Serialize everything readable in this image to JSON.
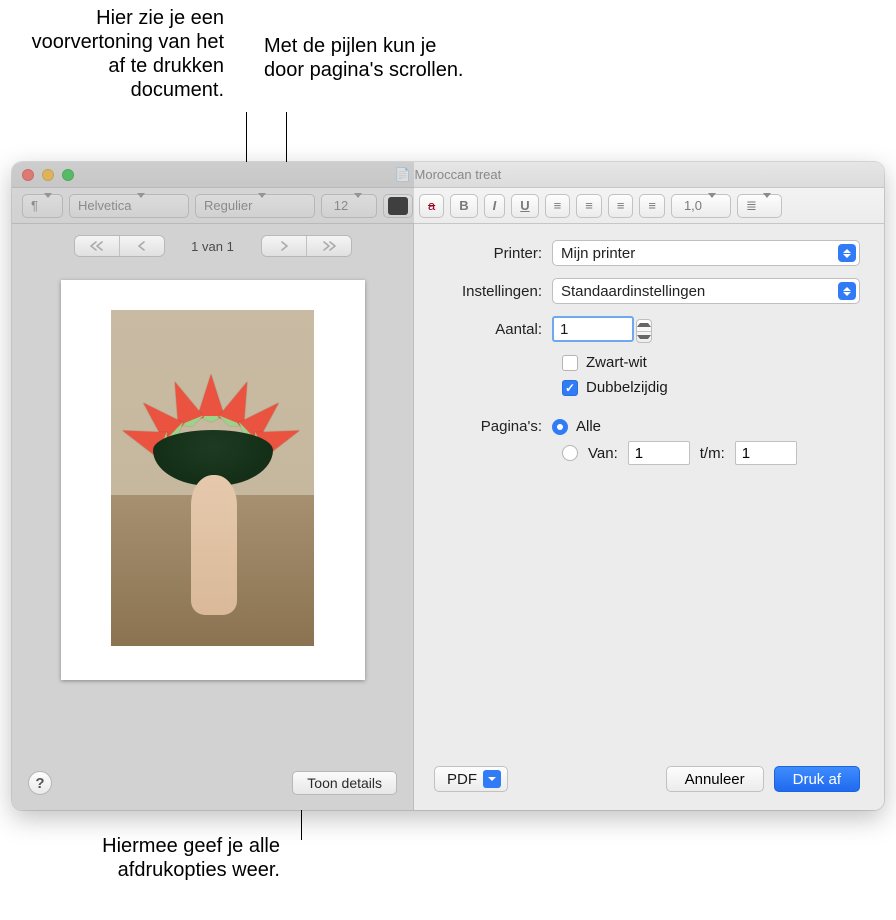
{
  "annotations": {
    "preview_hint": "Hier zie je een voorvertoning van het af te drukken document.",
    "arrows_hint": "Met de pijlen kun je door pagina's scrollen.",
    "details_hint": "Hiermee geef je alle afdrukopties weer."
  },
  "window": {
    "title": "Moroccan treat"
  },
  "toolbar": {
    "font_family": "Helvetica",
    "font_style": "Regulier",
    "font_size": "12",
    "line_spacing": "1,0",
    "bold": "B",
    "italic": "I",
    "underline": "U"
  },
  "preview": {
    "page_indicator": "1 van 1"
  },
  "form": {
    "printer_label": "Printer:",
    "printer_value": "Mijn printer",
    "settings_label": "Instellingen:",
    "settings_value": "Standaardinstellingen",
    "copies_label": "Aantal:",
    "copies_value": "1",
    "bw_label": "Zwart-wit",
    "duplex_label": "Dubbelzijdig",
    "pages_label": "Pagina's:",
    "pages_all": "Alle",
    "pages_from": "Van:",
    "pages_from_value": "1",
    "pages_to": "t/m:",
    "pages_to_value": "1"
  },
  "buttons": {
    "help": "?",
    "show_details": "Toon details",
    "pdf": "PDF",
    "cancel": "Annuleer",
    "print": "Druk af"
  }
}
